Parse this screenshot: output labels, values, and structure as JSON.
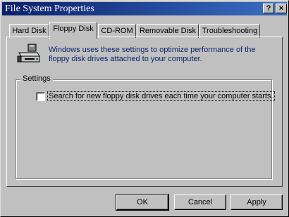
{
  "window": {
    "title": "File System Properties"
  },
  "titlebar_buttons": {
    "help": "?",
    "close": "×"
  },
  "tabs": [
    {
      "label": "Hard Disk"
    },
    {
      "label": "Floppy Disk"
    },
    {
      "label": "CD-ROM"
    },
    {
      "label": "Removable Disk"
    },
    {
      "label": "Troubleshooting"
    }
  ],
  "active_tab": "Floppy Disk",
  "panel": {
    "icon": "floppy-drive-icon",
    "description": "Windows uses these settings to optimize performance of the floppy disk drives attached to your computer.",
    "settings_group": {
      "label": "Settings",
      "checkbox": {
        "label": "Search for new floppy disk drives each time your computer starts.",
        "checked": false
      }
    }
  },
  "buttons": {
    "ok": "OK",
    "cancel": "Cancel",
    "apply": "Apply"
  }
}
